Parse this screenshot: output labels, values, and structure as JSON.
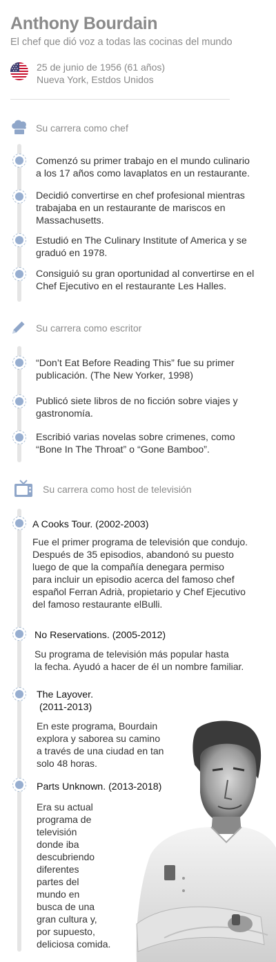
{
  "header": {
    "name": "Anthony Bourdain",
    "tagline": "El chef que dió voz a todas las cocinas del mundo",
    "birth_date": "25 de junio de 1956 (61 años)",
    "birth_place": "Nueva York, Estdos Unidos"
  },
  "sections": {
    "chef": {
      "icon": "chef-hat-icon",
      "title": "Su carrera como chef",
      "items": [
        [
          "Comenzó su primer trabajo en el mundo culinario",
          "a los 17 años como lavaplatos en un restaurante."
        ],
        [
          "Decidió convertirse en chef profesional mientras",
          "trabajaba en un restaurante de mariscos en",
          "Massachusetts."
        ],
        [
          "Estudió en The Culinary Institute of America y se",
          "graduó en 1978."
        ],
        [
          "Consiguió su gran oportunidad al convertirse en el",
          "Chef Ejecutivo en el restaurante Les Halles."
        ]
      ]
    },
    "writer": {
      "icon": "pencil-icon",
      "title": "Su carrera como escritor",
      "items": [
        [
          "“Don’t Eat Before Reading This” fue su primer",
          "publicación. (The New Yorker, 1998)"
        ],
        [
          "Publicó siete libros de no ficción sobre viajes y",
          "gastronomía."
        ],
        [
          "Escribió varias novelas sobre crimenes, como",
          "“Bone In The Throat” o “Gone Bamboo”."
        ]
      ]
    },
    "tv": {
      "icon": "television-icon",
      "title": "Su carrera como host de televisión",
      "shows": [
        {
          "title": [
            "A Cooks Tour. (2002-2003)"
          ],
          "text": [
            "Fue el primer programa de televisión que condujo.",
            "Después de 35 episodios, abandonó su puesto",
            "luego de que la compañía denegara permiso",
            "para incluir un episodio acerca del famoso chef",
            "español Ferran Adrià, propietario y Chef Ejecutivo",
            "del famoso restaurante elBulli."
          ]
        },
        {
          "title": [
            "No Reservations. (2005-2012)"
          ],
          "text": [
            "Su programa de televisión más popular hasta",
            "la fecha. Ayudó a hacer de él un nombre familiar."
          ]
        },
        {
          "title": [
            "The Layover.",
            " (2011-2013)"
          ],
          "text": [
            "En este programa, Bourdain",
            "explora y saborea su camino",
            "a través de una ciudad en tan",
            "solo 48 horas."
          ]
        },
        {
          "title": [
            "Parts Unknown. (2013-2018)"
          ],
          "text": [
            "Era su actual",
            "programa de",
            "televisión",
            "donde iba",
            "descubriendo",
            "diferentes",
            "partes del",
            "mundo en",
            "busca de una",
            "gran cultura y,",
            "por supuesto,",
            "deliciosa comida."
          ]
        }
      ]
    }
  }
}
